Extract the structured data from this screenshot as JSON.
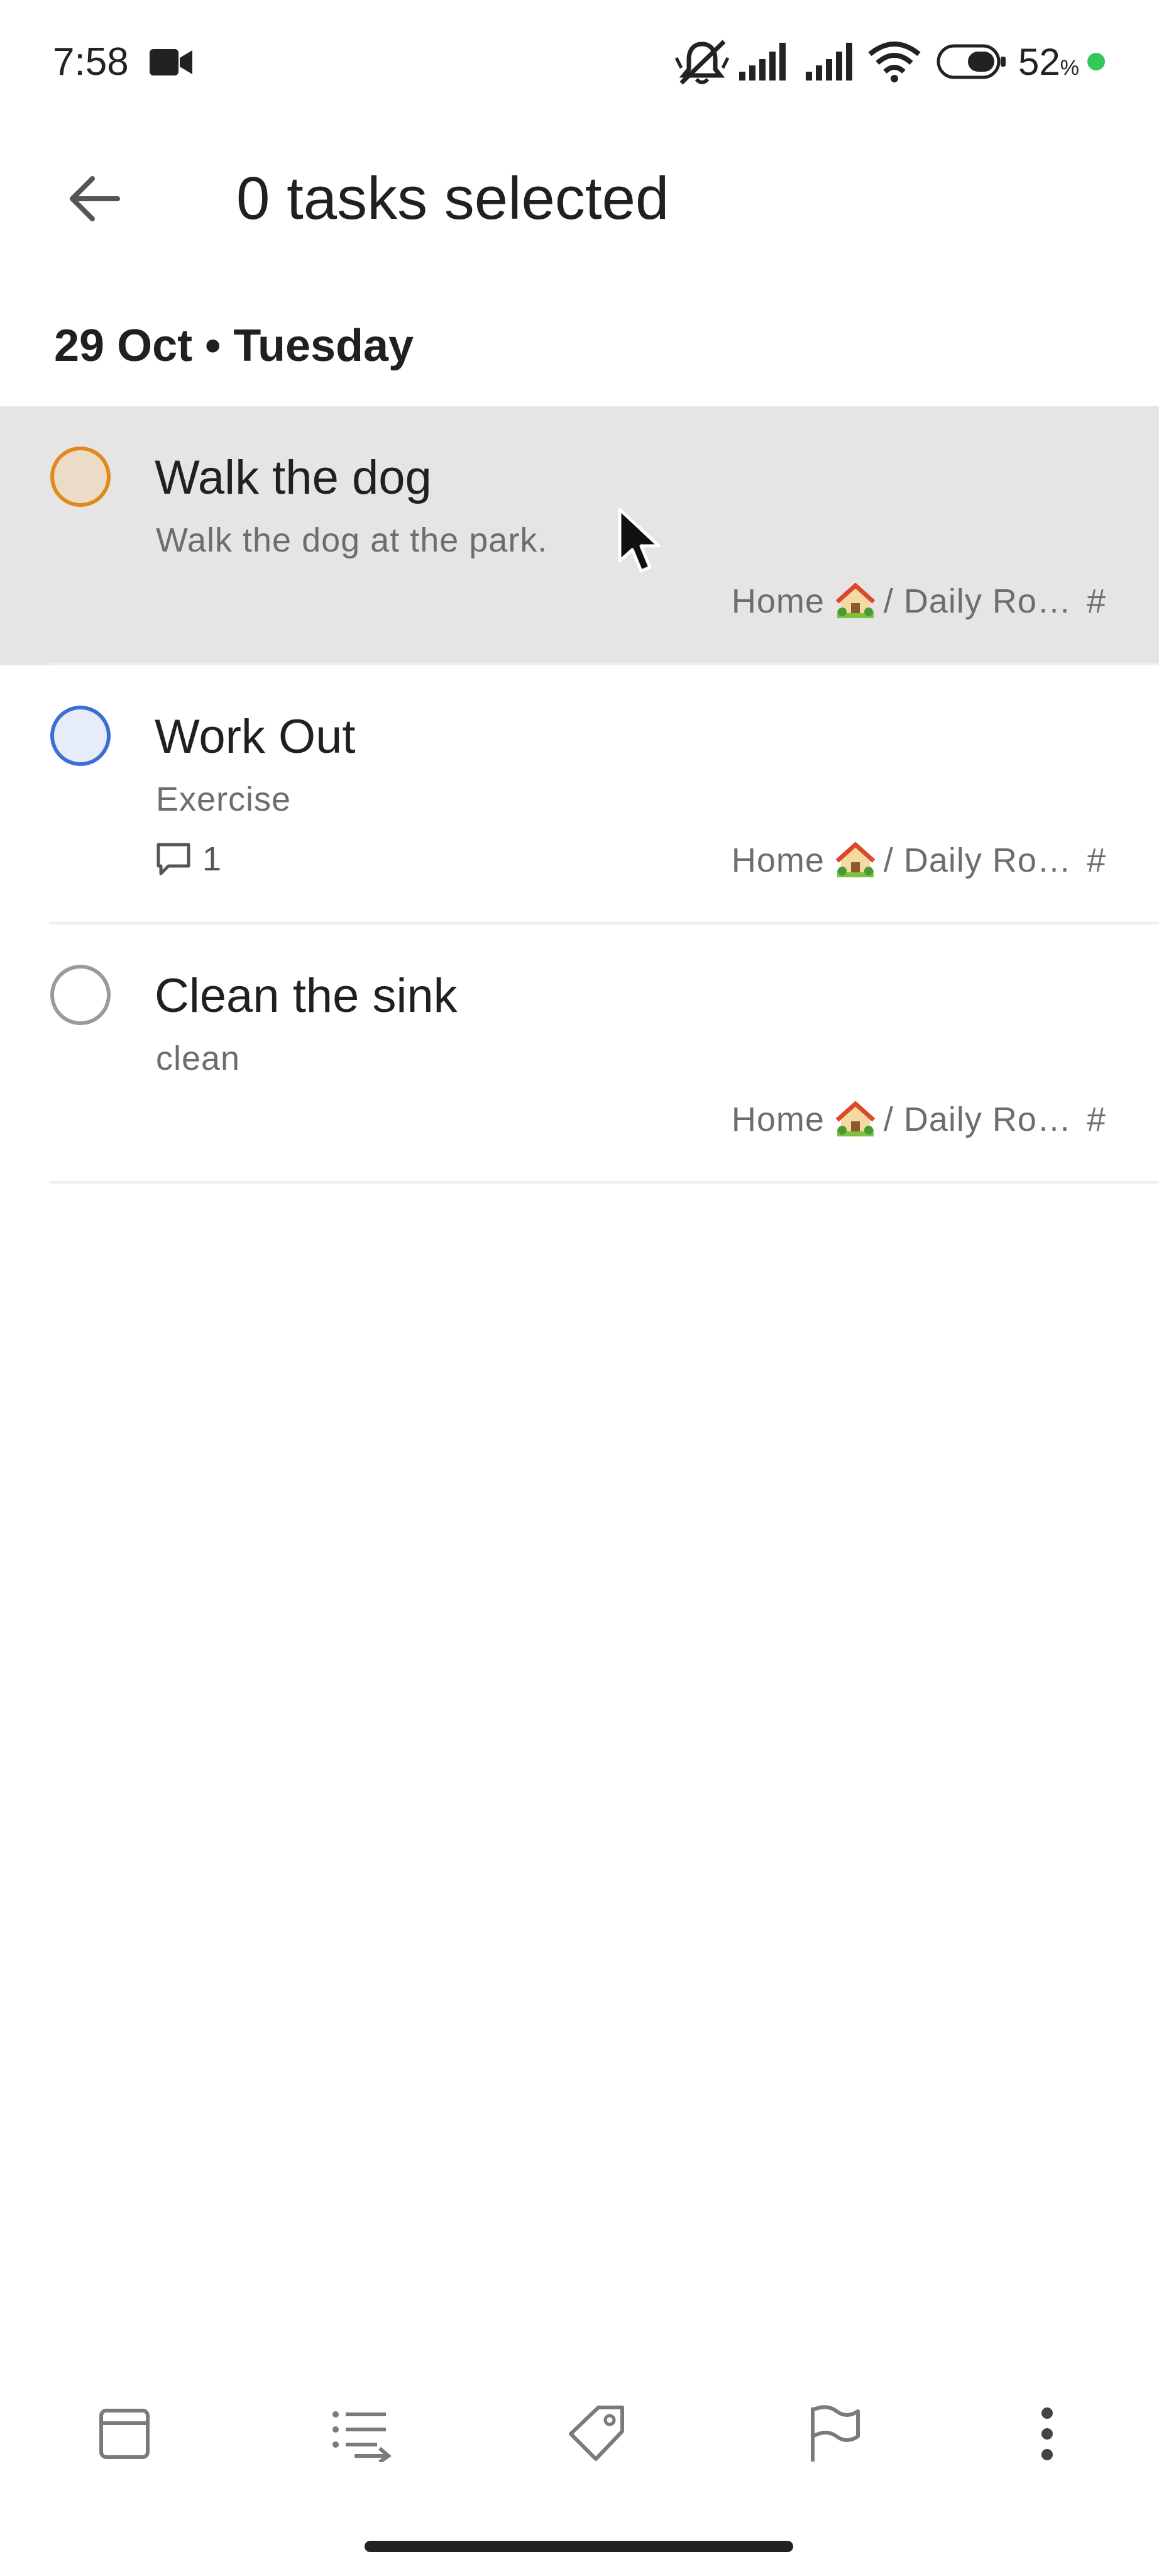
{
  "status_bar": {
    "time": "7:58",
    "battery_percent": "52",
    "battery_unit": "%",
    "icons": [
      "video-camera-icon",
      "silent-icon",
      "signal-icon",
      "signal-icon",
      "wifi-icon",
      "battery-icon",
      "dot-icon"
    ],
    "dot_color": "#34c759"
  },
  "app_bar": {
    "title": "0 tasks selected",
    "back_icon": "arrow-left-icon"
  },
  "section": {
    "header": "29 Oct • Tuesday"
  },
  "tasks": [
    {
      "title": "Walk the dog",
      "description": "Walk the dog at the park.",
      "project": "Home",
      "project_emoji": "house-with-garden",
      "subproject": "/ Daily Ro…",
      "hash": "#",
      "comments": null,
      "priority_color": "#e08a1e",
      "fill_color": "#ecdcc7",
      "highlighted": true
    },
    {
      "title": "Work Out",
      "description": "Exercise",
      "project": "Home",
      "project_emoji": "house-with-garden",
      "subproject": "/ Daily Ro…",
      "hash": "#",
      "comments": "1",
      "priority_color": "#3a6fd6",
      "fill_color": "#e6edf9",
      "highlighted": false
    },
    {
      "title": "Clean the sink",
      "description": "clean",
      "project": "Home",
      "project_emoji": "house-with-garden",
      "subproject": "/ Daily Ro…",
      "hash": "#",
      "comments": null,
      "priority_color": "#9a9a9a",
      "fill_color": "transparent",
      "highlighted": false
    }
  ],
  "toolbar": {
    "icons": [
      "schedule-icon",
      "move-icon",
      "label-icon",
      "priority-flag-icon",
      "more-vert-icon"
    ],
    "icon_color": "#7a7a7a"
  }
}
